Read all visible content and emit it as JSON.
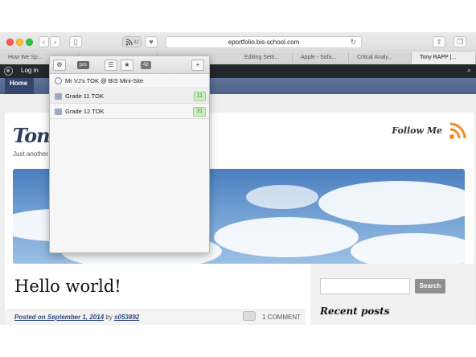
{
  "browser": {
    "url": "eportfolio.bis-school.com",
    "feed_count": "42",
    "tabs": [
      {
        "label": "How We Sp..."
      },
      {
        "label": ""
      },
      {
        "label": "Editing Setti..."
      },
      {
        "label": "Apple - Safa..."
      },
      {
        "label": "Critcal Analy..."
      },
      {
        "label": "Tony RAPP |..."
      }
    ]
  },
  "adminbar": {
    "login": "Log in"
  },
  "sitenav": {
    "home": "Home"
  },
  "site": {
    "title": "Tony",
    "tagline": "Just another",
    "follow": "Follow Me"
  },
  "post": {
    "title": "Hello world!",
    "posted_on": "Posted on September 1, 2014",
    "by": "by",
    "author": "s053892",
    "comments": "1 COMMENT"
  },
  "sidebar": {
    "search_button": "Search",
    "recent_heading": "Recent posts"
  },
  "popup": {
    "pro": "pro",
    "count": "42",
    "plus": "+",
    "site": "Mr VJ's TOK @ BIS Mini-Site",
    "feeds": [
      {
        "name": "Grade 11 TOK",
        "count": "11"
      },
      {
        "name": "Grade 12 TOK",
        "count": "31"
      }
    ]
  },
  "colors": {
    "admin_bar": "#23282d",
    "nav_bar": "#5f739b",
    "rss_orange": "#f28c22",
    "feed_count_green": "#3d8a2a"
  }
}
